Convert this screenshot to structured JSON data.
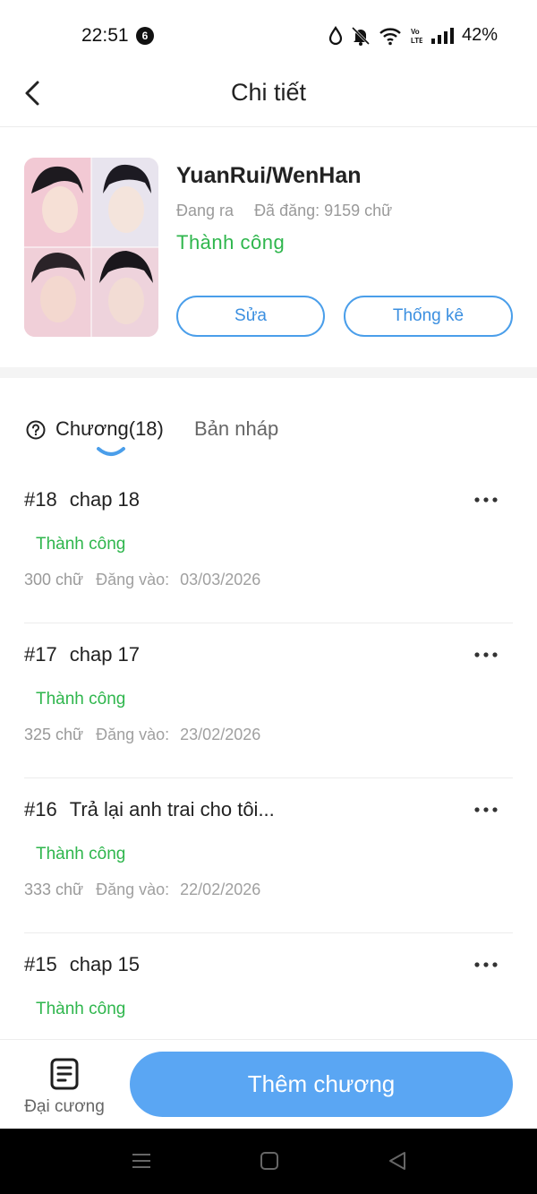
{
  "status_bar": {
    "time": "22:51",
    "notification_count": "6",
    "battery": "42%",
    "network_label": "Vo LTE"
  },
  "header": {
    "title": "Chi tiết"
  },
  "book": {
    "title": "YuanRui/WenHan",
    "state": "Đang ra",
    "posted": "Đã đăng: 9159 chữ",
    "status": "Thành công",
    "edit_label": "Sửa",
    "stats_label": "Thống kê"
  },
  "tabs": {
    "chapters_label": "Chương(18)",
    "drafts_label": "Bản nháp"
  },
  "chapters": [
    {
      "number": "#18",
      "title": "chap 18",
      "status": "Thành công",
      "words": "300 chữ",
      "posted_label": "Đăng vào:",
      "date": "03/03/2026"
    },
    {
      "number": "#17",
      "title": "chap 17",
      "status": "Thành công",
      "words": "325 chữ",
      "posted_label": "Đăng vào:",
      "date": "23/02/2026"
    },
    {
      "number": "#16",
      "title": "Trả lại anh trai cho tôi...",
      "status": "Thành công",
      "words": "333 chữ",
      "posted_label": "Đăng vào:",
      "date": "22/02/2026"
    },
    {
      "number": "#15",
      "title": "chap 15",
      "status": "Thành công",
      "words": "",
      "posted_label": "",
      "date": ""
    }
  ],
  "bottom": {
    "outline_label": "Đại cương",
    "add_chapter_label": "Thêm chương"
  },
  "colors": {
    "accent_blue": "#5aa6f3",
    "success_green": "#2fb64d",
    "muted_text": "#9a9a9a"
  },
  "icons": {
    "back": "chevron-left-icon",
    "help": "question-circle-icon",
    "more": "more-horizontal-icon",
    "outline": "document-icon"
  }
}
